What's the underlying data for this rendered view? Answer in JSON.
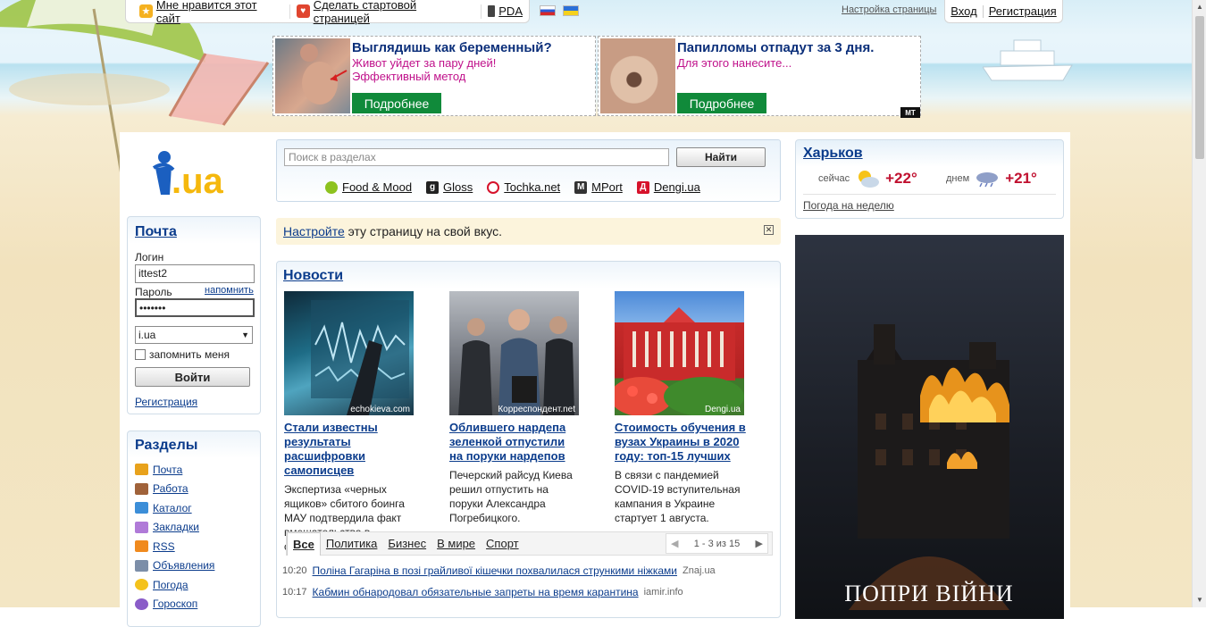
{
  "topbar": {
    "like_site": "Мне нравится этот сайт",
    "make_start": "Сделать стартовой страницей",
    "pda": "PDA",
    "settings": "Настройка страницы",
    "login": "Вход",
    "register": "Регистрация"
  },
  "ads": [
    {
      "title": "Выглядишь как беременный?",
      "line1": "Живот уйдет за пару дней!",
      "line2": "Эффективный метод",
      "button": "Подробнее"
    },
    {
      "title": "Папилломы отпадут за 3 дня.",
      "line1": "Для этого нанесите...",
      "line2": "",
      "button": "Подробнее"
    }
  ],
  "ads_badge": "MT",
  "logo": {
    "i": "i",
    "ua": ".ua"
  },
  "mail": {
    "title": "Почта",
    "login_label": "Логин",
    "login_value": "ittest2",
    "password_label": "Пароль",
    "remind": "напомнить",
    "password_value": "•••••••",
    "domain": "i.ua",
    "remember": "запомнить меня",
    "submit": "Войти",
    "register": "Регистрация"
  },
  "sections": {
    "title": "Разделы",
    "items": [
      {
        "label": "Почта",
        "color": "#e8a21c"
      },
      {
        "label": "Работа",
        "color": "#a0623a"
      },
      {
        "label": "Каталог",
        "color": "#3c8ed8"
      },
      {
        "label": "Закладки",
        "color": "#b07ad8"
      },
      {
        "label": "RSS",
        "color": "#f08a1e"
      },
      {
        "label": "Объявления",
        "color": "#7c8ea8"
      },
      {
        "label": "Погода",
        "color": "#f4c21c"
      },
      {
        "label": "Гороскоп",
        "color": "#8a5cc8"
      }
    ]
  },
  "search": {
    "placeholder": "Поиск в разделах",
    "button": "Найти",
    "partners": [
      {
        "label": "Food & Mood",
        "color": "#8dc21f",
        "glyph": ""
      },
      {
        "label": "Gloss",
        "color": "#222222",
        "glyph": "g"
      },
      {
        "label": "Tochka.net",
        "color": "#d6122b",
        "glyph": "◉"
      },
      {
        "label": "MPort",
        "color": "#333333",
        "glyph": "M"
      },
      {
        "label": "Dengi.ua",
        "color": "#d6122b",
        "glyph": "Д"
      }
    ]
  },
  "customize": {
    "link": "Настройте",
    "rest": " эту страницу на свой вкус."
  },
  "news": {
    "title": "Новости",
    "cards": [
      {
        "source": "echokieva.com",
        "title": "Стали известны результаты расшифровки самописцев",
        "text": "Экспертиза «черных ящиков» сбитого боинга МАУ подтвердила факт вмешательства в самолет."
      },
      {
        "source": "Корреспондент.net",
        "title": "Облившего нардепа зеленкой отпустили на поруки нардепов",
        "text": "Печерский райсуд Киева решил отпустить на поруки Александра Погребицкого."
      },
      {
        "source": "Dengi.ua",
        "title": "Стоимость обучения в вузах Украины в 2020 году: топ-15 лучших",
        "text": "В связи с пандемией COVID-19 вступительная кампания в Украине стартует 1 августа."
      }
    ],
    "tabs": [
      "Все",
      "Политика",
      "Бизнес",
      "В мире",
      "Спорт"
    ],
    "pager": "1 - 3 из 15",
    "list": [
      {
        "time": "10:20",
        "title": "Поліна Гагаріна в позі грайливої кішечки похвалилася стрункими ніжками",
        "source": "Znaj.ua"
      },
      {
        "time": "10:17",
        "title": "Кабмин обнародовал обязательные запреты на время карантина",
        "source": "iamir.info"
      }
    ]
  },
  "weather": {
    "city": "Харьков",
    "now_label": "сейчас",
    "now_temp": "+22°",
    "day_label": "днем",
    "day_temp": "+21°",
    "week_link": "Погода на неделю"
  },
  "banner": {
    "text": "ПОПРИ ВІЙНИ"
  }
}
